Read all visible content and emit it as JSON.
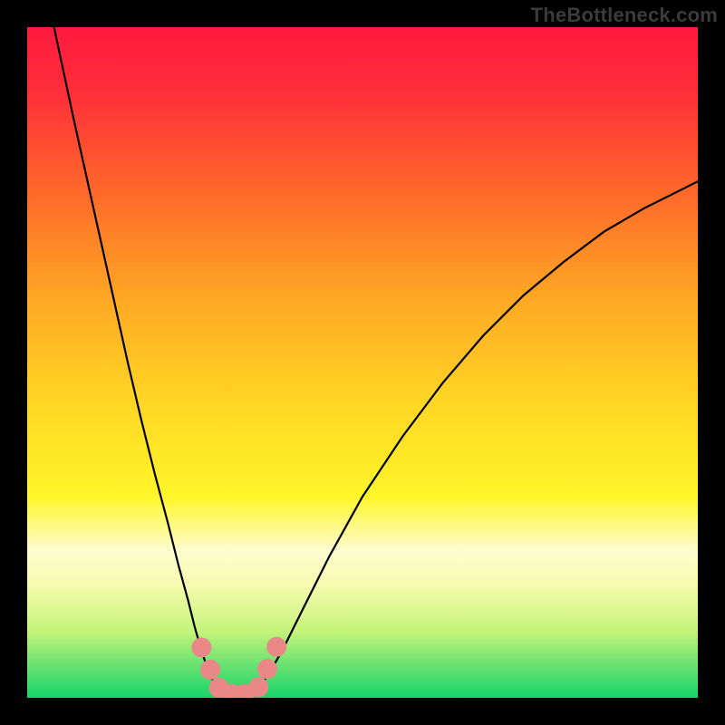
{
  "watermark": "TheBottleneck.com",
  "chart_data": {
    "type": "line",
    "title": "",
    "xlabel": "",
    "ylabel": "",
    "xlim": [
      0,
      100
    ],
    "ylim": [
      0,
      100
    ],
    "gradient_stops": [
      {
        "offset": 0.0,
        "color": "#ff1a3f"
      },
      {
        "offset": 0.1,
        "color": "#ff2f3a"
      },
      {
        "offset": 0.25,
        "color": "#ff6a2a"
      },
      {
        "offset": 0.4,
        "color": "#ffa624"
      },
      {
        "offset": 0.55,
        "color": "#ffd424"
      },
      {
        "offset": 0.7,
        "color": "#fff62a"
      },
      {
        "offset": 0.78,
        "color": "#fdfccf"
      },
      {
        "offset": 0.83,
        "color": "#f7fbb0"
      },
      {
        "offset": 0.9,
        "color": "#c6f47a"
      },
      {
        "offset": 0.95,
        "color": "#6be272"
      },
      {
        "offset": 1.0,
        "color": "#18d56a"
      }
    ],
    "series": [
      {
        "name": "curve-left",
        "color": "#000000",
        "width": 2.2,
        "points": [
          {
            "x": 4.0,
            "y": 100.0
          },
          {
            "x": 5.5,
            "y": 93.0
          },
          {
            "x": 7.0,
            "y": 86.0
          },
          {
            "x": 9.0,
            "y": 77.0
          },
          {
            "x": 11.0,
            "y": 68.0
          },
          {
            "x": 13.0,
            "y": 59.0
          },
          {
            "x": 15.0,
            "y": 50.0
          },
          {
            "x": 17.0,
            "y": 41.5
          },
          {
            "x": 19.0,
            "y": 33.5
          },
          {
            "x": 21.0,
            "y": 26.0
          },
          {
            "x": 22.5,
            "y": 20.0
          },
          {
            "x": 24.0,
            "y": 14.5
          },
          {
            "x": 25.0,
            "y": 10.5
          },
          {
            "x": 26.0,
            "y": 7.0
          },
          {
            "x": 27.0,
            "y": 4.0
          },
          {
            "x": 28.0,
            "y": 2.0
          },
          {
            "x": 29.0,
            "y": 0.8
          },
          {
            "x": 30.0,
            "y": 0.3
          },
          {
            "x": 31.5,
            "y": 0.3
          }
        ]
      },
      {
        "name": "curve-right",
        "color": "#000000",
        "width": 2.2,
        "points": [
          {
            "x": 31.5,
            "y": 0.3
          },
          {
            "x": 33.0,
            "y": 0.5
          },
          {
            "x": 34.5,
            "y": 1.5
          },
          {
            "x": 36.0,
            "y": 3.5
          },
          {
            "x": 38.0,
            "y": 7.0
          },
          {
            "x": 41.0,
            "y": 13.0
          },
          {
            "x": 45.0,
            "y": 21.0
          },
          {
            "x": 50.0,
            "y": 30.0
          },
          {
            "x": 56.0,
            "y": 39.0
          },
          {
            "x": 62.0,
            "y": 47.0
          },
          {
            "x": 68.0,
            "y": 54.0
          },
          {
            "x": 74.0,
            "y": 60.0
          },
          {
            "x": 80.0,
            "y": 65.0
          },
          {
            "x": 86.0,
            "y": 69.5
          },
          {
            "x": 92.0,
            "y": 73.0
          },
          {
            "x": 97.0,
            "y": 75.5
          },
          {
            "x": 100.0,
            "y": 77.0
          }
        ]
      }
    ],
    "markers": {
      "name": "bottom-cluster",
      "color": "#e98886",
      "radius": 11,
      "points": [
        {
          "x": 26.0,
          "y": 7.5
        },
        {
          "x": 27.3,
          "y": 4.2
        },
        {
          "x": 28.6,
          "y": 1.5
        },
        {
          "x": 30.5,
          "y": 0.6
        },
        {
          "x": 32.4,
          "y": 0.6
        },
        {
          "x": 34.5,
          "y": 1.6
        },
        {
          "x": 35.8,
          "y": 4.3
        },
        {
          "x": 37.2,
          "y": 7.6
        }
      ]
    }
  }
}
